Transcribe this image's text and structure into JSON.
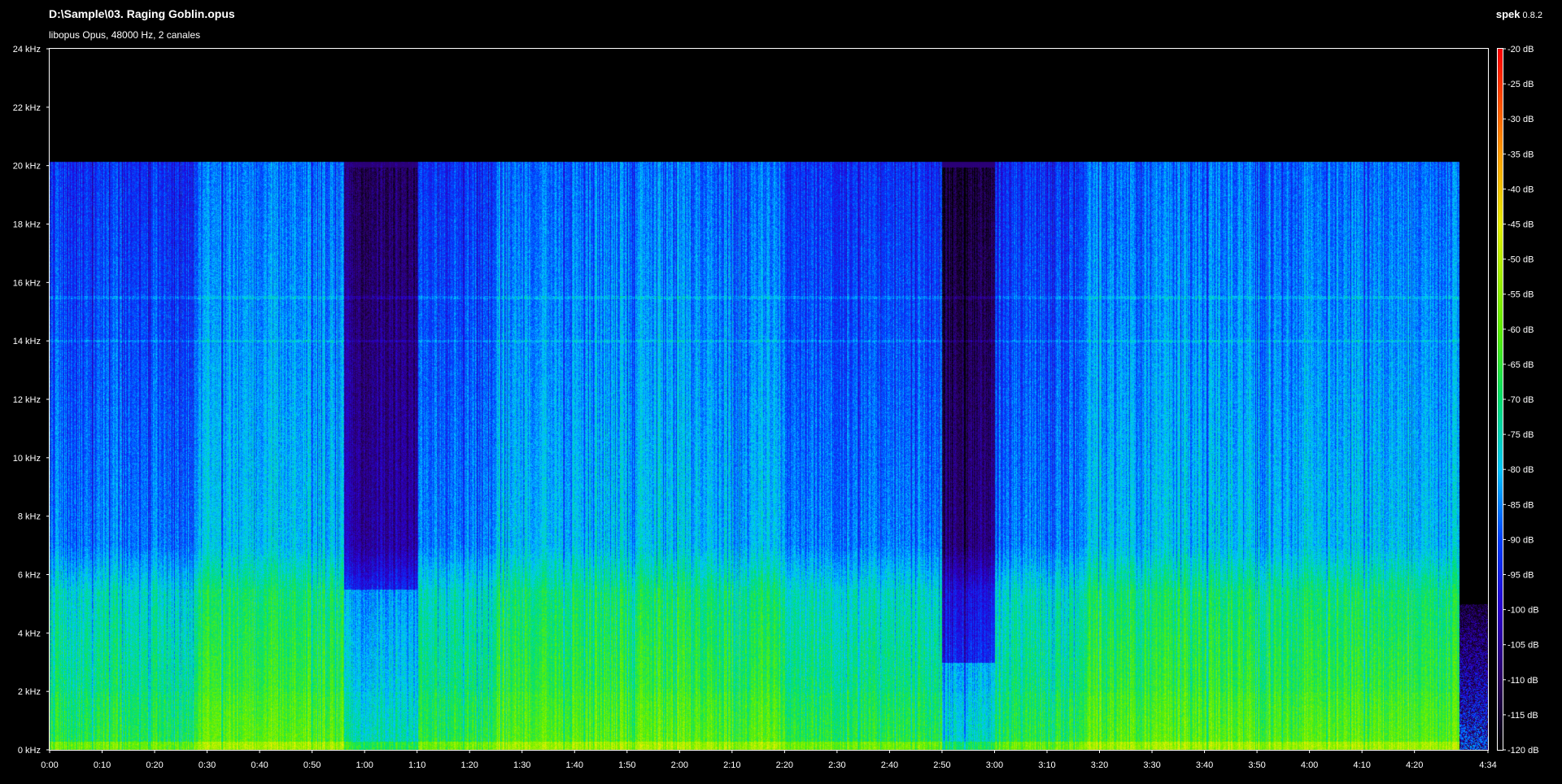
{
  "header": {
    "file_title": "D:\\Sample\\03. Raging Goblin.opus",
    "stream_info": "libopus Opus, 48000 Hz, 2 canales",
    "app_name": "spek",
    "app_version": "0.8.2"
  },
  "chart_data": {
    "type": "heatmap",
    "title": "D:\\Sample\\03. Raging Goblin.opus",
    "subtitle": "libopus Opus, 48000 Hz, 2 canales",
    "xlabel": "",
    "ylabel": "",
    "x_unit": "time (m:ss)",
    "y_unit": "kHz",
    "xlim_seconds": [
      0,
      274
    ],
    "ylim_khz": [
      0,
      24
    ],
    "x_ticks": [
      "0:00",
      "0:10",
      "0:20",
      "0:30",
      "0:40",
      "0:50",
      "1:00",
      "1:10",
      "1:20",
      "1:30",
      "1:40",
      "1:50",
      "2:00",
      "2:10",
      "2:20",
      "2:30",
      "2:40",
      "2:50",
      "3:00",
      "3:10",
      "3:20",
      "3:30",
      "3:40",
      "3:50",
      "4:00",
      "4:10",
      "4:20",
      "4:34"
    ],
    "x_tick_seconds": [
      0,
      10,
      20,
      30,
      40,
      50,
      60,
      70,
      80,
      90,
      100,
      110,
      120,
      130,
      140,
      150,
      160,
      170,
      180,
      190,
      200,
      210,
      220,
      230,
      240,
      250,
      260,
      274
    ],
    "y_ticks": [
      "0 kHz",
      "2 kHz",
      "4 kHz",
      "6 kHz",
      "8 kHz",
      "10 kHz",
      "12 kHz",
      "14 kHz",
      "16 kHz",
      "18 kHz",
      "20 kHz",
      "22 kHz",
      "24 kHz"
    ],
    "y_tick_khz": [
      0,
      2,
      4,
      6,
      8,
      10,
      12,
      14,
      16,
      18,
      20,
      22,
      24
    ],
    "colorbar_labels": [
      "-20 dB",
      "-25 dB",
      "-30 dB",
      "-35 dB",
      "-40 dB",
      "-45 dB",
      "-50 dB",
      "-55 dB",
      "-60 dB",
      "-65 dB",
      "-70 dB",
      "-75 dB",
      "-80 dB",
      "-85 dB",
      "-90 dB",
      "-95 dB",
      "-100 dB",
      "-105 dB",
      "-110 dB",
      "-115 dB",
      "-120 dB"
    ],
    "colorbar_db": [
      -20,
      -25,
      -30,
      -35,
      -40,
      -45,
      -50,
      -55,
      -60,
      -65,
      -70,
      -75,
      -80,
      -85,
      -90,
      -95,
      -100,
      -105,
      -110,
      -115,
      -120
    ],
    "db_range": [
      -120,
      -20
    ],
    "colormap_stops": [
      {
        "db": -120,
        "color": "#000000"
      },
      {
        "db": -110,
        "color": "#2a0060"
      },
      {
        "db": -100,
        "color": "#2a00d0"
      },
      {
        "db": -90,
        "color": "#0040ff"
      },
      {
        "db": -80,
        "color": "#00c8ff"
      },
      {
        "db": -70,
        "color": "#00e070"
      },
      {
        "db": -60,
        "color": "#60f000"
      },
      {
        "db": -45,
        "color": "#e8f000"
      },
      {
        "db": -35,
        "color": "#ffa000"
      },
      {
        "db": -20,
        "color": "#ff0000"
      }
    ],
    "lowpass_cutoff_khz": 20,
    "signal_end_seconds": 268.5,
    "sections": [
      {
        "start_s": 0,
        "end_s": 28,
        "level": "medium"
      },
      {
        "start_s": 28,
        "end_s": 56,
        "level": "high"
      },
      {
        "start_s": 56,
        "end_s": 70,
        "level": "quiet"
      },
      {
        "start_s": 70,
        "end_s": 85,
        "level": "medium"
      },
      {
        "start_s": 85,
        "end_s": 140,
        "level": "high"
      },
      {
        "start_s": 140,
        "end_s": 170,
        "level": "medium"
      },
      {
        "start_s": 170,
        "end_s": 180,
        "level": "drop"
      },
      {
        "start_s": 180,
        "end_s": 197,
        "level": "medium"
      },
      {
        "start_s": 197,
        "end_s": 258,
        "level": "high"
      },
      {
        "start_s": 258,
        "end_s": 268.5,
        "level": "high"
      },
      {
        "start_s": 268.5,
        "end_s": 274,
        "level": "tail"
      }
    ]
  }
}
